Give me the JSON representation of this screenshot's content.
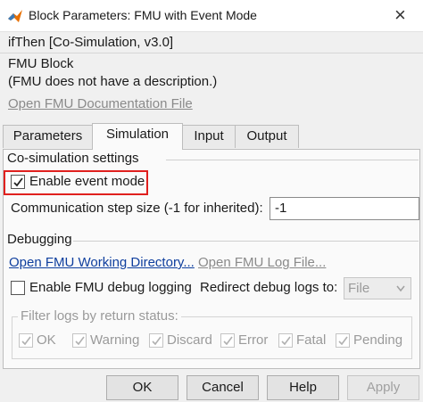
{
  "window": {
    "title": "Block Parameters: FMU with Event Mode",
    "close_glyph": "×"
  },
  "header": {
    "block_type": "ifThen [Co-Simulation, v3.0]",
    "block_name": "FMU Block",
    "description": "(FMU does not have a description.)",
    "doc_link": "Open FMU Documentation File"
  },
  "tabs": [
    {
      "label": "Parameters",
      "active": false
    },
    {
      "label": "Simulation",
      "active": true
    },
    {
      "label": "Input",
      "active": false
    },
    {
      "label": "Output",
      "active": false
    }
  ],
  "cosim": {
    "section_label": "Co-simulation settings",
    "enable_event_mode": {
      "label": "Enable event mode",
      "checked": true
    },
    "step_size": {
      "label": "Communication step size (-1 for inherited):",
      "value": "-1"
    }
  },
  "debugging": {
    "section_label": "Debugging",
    "open_working_dir": "Open FMU Working Directory...",
    "open_log_file": "Open FMU Log File...",
    "enable_debug_logging": {
      "label": "Enable FMU debug logging",
      "checked": false
    },
    "redirect": {
      "label": "Redirect debug logs to:",
      "value": "File"
    },
    "filter": {
      "label": "Filter logs by return status:",
      "options": [
        {
          "label": "OK",
          "checked": true
        },
        {
          "label": "Warning",
          "checked": true
        },
        {
          "label": "Discard",
          "checked": true
        },
        {
          "label": "Error",
          "checked": true
        },
        {
          "label": "Fatal",
          "checked": true
        },
        {
          "label": "Pending",
          "checked": true
        }
      ]
    }
  },
  "buttons": {
    "ok": "OK",
    "cancel": "Cancel",
    "help": "Help",
    "apply": "Apply"
  },
  "colors": {
    "highlight": "#e0201e",
    "link": "#0f3f9e"
  }
}
